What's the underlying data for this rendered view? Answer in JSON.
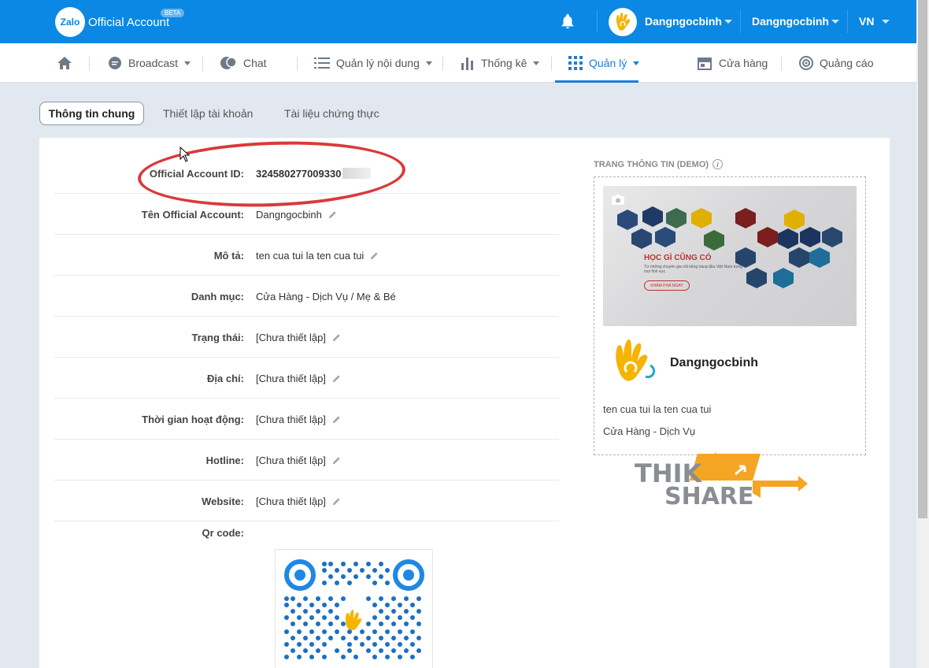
{
  "topbar": {
    "logo_mark": "Zalo",
    "logo_text": "Official Account",
    "beta_badge": "BETA",
    "user_name": "Dangngocbinh",
    "account_name": "Dangngocbinh",
    "language": "VN",
    "bg_color": "#0a88e3"
  },
  "nav": {
    "items": [
      {
        "label": "Broadcast",
        "icon": "chat-bubble-icon"
      },
      {
        "label": "Chat",
        "icon": "chat-icon"
      },
      {
        "label": "Quản lý nội dung",
        "icon": "list-icon"
      },
      {
        "label": "Thống kê",
        "icon": "bar-chart-icon"
      },
      {
        "label": "Quản lý",
        "icon": "grid-icon"
      },
      {
        "label": "Cửa hàng",
        "icon": "store-icon"
      },
      {
        "label": "Quảng cáo",
        "icon": "target-icon"
      }
    ],
    "active": "Quản lý",
    "accent_color": "#1a7ed6"
  },
  "tabs": [
    "Thông tin chung",
    "Thiết lập tài khoản",
    "Tài liệu chứng thực"
  ],
  "info": {
    "rows": [
      {
        "label": "Official Account ID:",
        "value": "324580277009330"
      },
      {
        "label": "Tên Official Account:",
        "value": "Dangngocbinh"
      },
      {
        "label": "Mô tả:",
        "value": "ten cua tui la ten cua tui"
      },
      {
        "label": "Danh mục:",
        "value": "Cửa Hàng - Dịch Vụ / Mẹ & Bé"
      },
      {
        "label": "Trạng thái:",
        "value": "[Chưa thiết lập]"
      },
      {
        "label": "Địa chỉ:",
        "value": "[Chưa thiết lập]"
      },
      {
        "label": "Thời gian hoạt động:",
        "value": "[Chưa thiết lập]"
      },
      {
        "label": "Hotline:",
        "value": "[Chưa thiết lập]"
      },
      {
        "label": "Website:",
        "value": "[Chưa thiết lập]"
      },
      {
        "label": "Qr code:",
        "value": ""
      }
    ]
  },
  "preview": {
    "title": "TRANG THÔNG TIN (DEMO)",
    "cover_title": "HỌC GÌ CŨNG CÓ",
    "cover_subtitle": "Từ những chuyên gia nổi tiếng hàng đầu Việt Nam trong mọi lĩnh vực",
    "cover_button": "KHÁM PHÁ NGAY",
    "name": "Dangngocbinh",
    "description": "ten cua tui la ten cua tui",
    "category": "Cửa Hàng - Dịch Vụ"
  },
  "watermark": {
    "line1": "THIK",
    "line2": "SHARE"
  }
}
